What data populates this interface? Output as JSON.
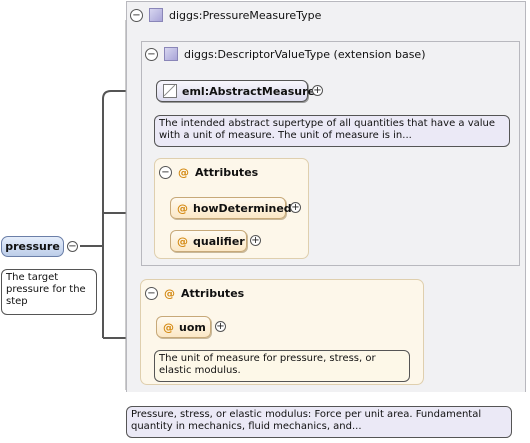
{
  "root_element": {
    "name": "pressure",
    "doc": "The target pressure for the step"
  },
  "outer_type": {
    "name": "diggs:PressureMeasureType",
    "doc": "Pressure, stress, or elastic modulus: Force per unit area. Fundamental quantity in mechanics, fluid mechanics, and..."
  },
  "base_type": {
    "name": "diggs:DescriptorValueType (extension base)"
  },
  "abstract_element": {
    "name": "eml:AbstractMeasure",
    "doc": "The intended abstract supertype of all quantities that have a value with a unit of measure. The unit of measure is in..."
  },
  "inner_attributes": {
    "header": "Attributes",
    "items": [
      "howDetermined",
      "qualifier"
    ]
  },
  "outer_attributes": {
    "header": "Attributes",
    "items": [
      "uom"
    ],
    "uom_doc": "The unit of measure for pressure, stress, or elastic modulus."
  },
  "icons": {
    "collapse": "minus-circle-icon",
    "expand": "plus-circle-icon",
    "attribute": "at-sign-icon",
    "type": "complex-type-icon"
  },
  "colors": {
    "element_fill": "#dcdbee",
    "attribute_fill": "#fbe8c6",
    "container_fill": "#f1f1f3"
  }
}
